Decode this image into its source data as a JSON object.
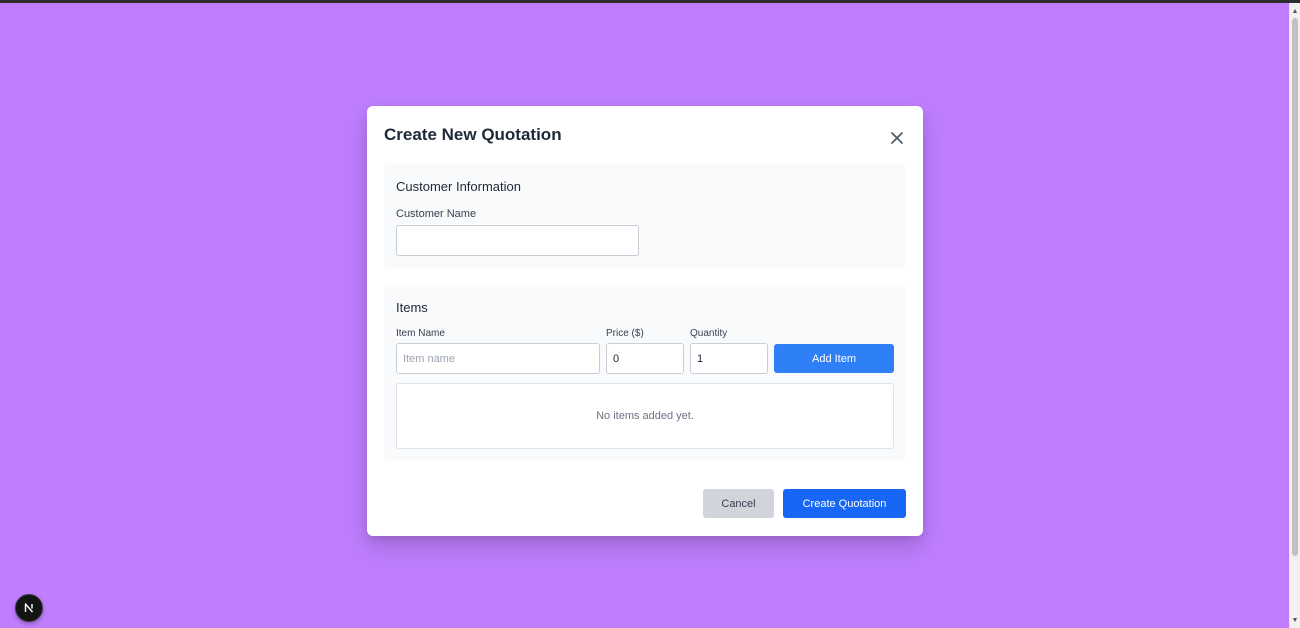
{
  "colors": {
    "page_background": "#c07eff",
    "modal_background": "#ffffff",
    "panel_background": "#f8fafc",
    "primary_button": "#2f7ff7",
    "create_button": "#1766f5",
    "cancel_button": "#d1d5db"
  },
  "modal": {
    "title": "Create New Quotation",
    "close_icon": "close-icon",
    "customer_section": {
      "heading": "Customer Information",
      "customer_name_label": "Customer Name",
      "customer_name_value": "",
      "customer_name_placeholder": ""
    },
    "items_section": {
      "heading": "Items",
      "item_name_label": "Item Name",
      "item_name_value": "",
      "item_name_placeholder": "Item name",
      "price_label": "Price ($)",
      "price_value": "0",
      "quantity_label": "Quantity",
      "quantity_value": "1",
      "add_item_label": "Add Item",
      "empty_message": "No items added yet."
    },
    "footer": {
      "cancel_label": "Cancel",
      "create_label": "Create Quotation"
    }
  },
  "dev_badge": {
    "icon": "nextjs-logo-icon",
    "letter": "N"
  }
}
